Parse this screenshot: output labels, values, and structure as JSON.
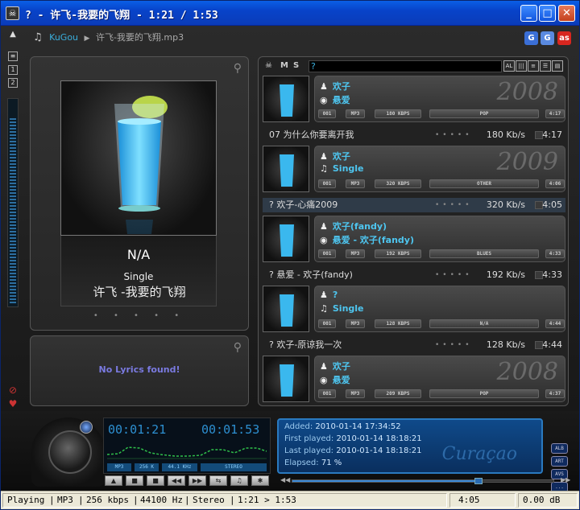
{
  "window": {
    "title": "? - 许飞-我要的飞翔 - 1:21 / 1:53",
    "min_glyph": "_",
    "max_glyph": "□",
    "close_glyph": "✕"
  },
  "header": {
    "app": "KuGou",
    "file": "许飞-我要的飞翔.mp3",
    "social": [
      "G",
      "G",
      "as"
    ]
  },
  "nowplaying": {
    "artist": "N/A",
    "album": "Single",
    "song": "许飞 -我要的飞翔",
    "dots": "• • • • •"
  },
  "lyrics": {
    "message": "No Lyrics found!"
  },
  "playlist_toolbar": {
    "m": "M",
    "s": "S",
    "search_text": "?",
    "tools": [
      "AL",
      "|||",
      "≡",
      "☰",
      "▤"
    ]
  },
  "albums": [
    {
      "artist": "欢子",
      "album": "悬爱",
      "year": "2008",
      "chips": [
        "001",
        "MP3",
        "180 KBPS",
        "POP",
        "4:17"
      ]
    },
    {
      "artist": "欢子",
      "album": "Single",
      "year": "2009",
      "chips": [
        "001",
        "MP3",
        "320 KBPS",
        "OTHER",
        "4:06"
      ]
    },
    {
      "artist": "欢子(fandy)",
      "album": "悬爱 - 欢子(fandy)",
      "year": "",
      "chips": [
        "001",
        "MP3",
        "192 KBPS",
        "BLUES",
        "4:33"
      ]
    },
    {
      "artist": "?",
      "album": "Single",
      "year": "",
      "chips": [
        "001",
        "MP3",
        "128 KBPS",
        "N/A",
        "4:44"
      ]
    },
    {
      "artist": "欢子",
      "album": "悬爱",
      "year": "2008",
      "chips": [
        "001",
        "MP3",
        "209 KBPS",
        "POP",
        "4:37"
      ]
    }
  ],
  "tracks": [
    {
      "title": "07 为什么你要离开我",
      "bitrate": "180 Kb/s",
      "duration": "4:17",
      "selected": false
    },
    {
      "title": "? 欢子-心痛2009",
      "bitrate": "320 Kb/s",
      "duration": "4:05",
      "selected": true
    },
    {
      "title": "? 悬爱 - 欢子(fandy)",
      "bitrate": "192 Kb/s",
      "duration": "4:33",
      "selected": false
    },
    {
      "title": "? 欢子-原谅我一次",
      "bitrate": "128 Kb/s",
      "duration": "4:44",
      "selected": false
    }
  ],
  "lcd": {
    "elapsed": "00:01:21",
    "total": "00:01:53",
    "chips": [
      "MP3",
      "256 K",
      "44.1 KHz",
      "STEREO"
    ]
  },
  "info": {
    "added_label": "Added:",
    "added": "2010-01-14 17:34:52",
    "first_label": "First played:",
    "first": "2010-01-14 18:18:21",
    "last_label": "Last played:",
    "last": "2010-01-14 18:18:21",
    "elapsed_label": "Elapsed:",
    "elapsed": "71 %",
    "elapsed_fraction": 0.71,
    "watermark": "Curaçao"
  },
  "side_buttons": [
    "ALB",
    "ART",
    "AVS",
    "..."
  ],
  "controls": [
    "▲",
    "■",
    "■",
    "◀◀",
    "▶▶",
    "⇆",
    "♫",
    "✱"
  ],
  "seek": {
    "progress": 0.71
  },
  "status": {
    "state": "Playing",
    "format": "MP3",
    "bitrate": "256 kbps",
    "rate": "44100 Hz",
    "channels": "Stereo",
    "position": "1:21 > 1:53",
    "length": "4:05",
    "gain": "0.00 dB"
  },
  "colors": {
    "accent": "#3aaedc",
    "titlebar": "#0843c9",
    "info_bg": "#0f4a8a"
  }
}
